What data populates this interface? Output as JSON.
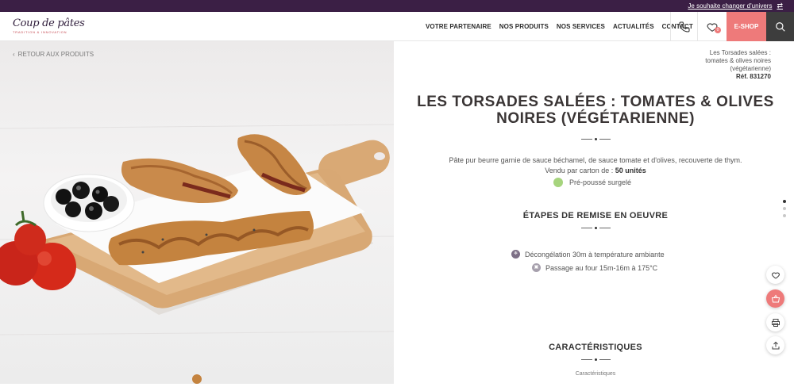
{
  "topbar": {
    "change_universe": "Je souhaite changer d'univers"
  },
  "brand": {
    "logo_text": "Coup de pâtes",
    "tagline": "tradition & innovation"
  },
  "nav": {
    "items": [
      "VOTRE PARTENAIRE",
      "NOS PRODUITS",
      "NOS SERVICES",
      "ACTUALITÉS",
      "CONTACT"
    ]
  },
  "header": {
    "wishlist_count": "0",
    "eshop_label": "E-SHOP"
  },
  "back_link": "RETOUR AUX PRODUITS",
  "reference": {
    "name_line1": "Les Torsades salées :",
    "name_line2": "tomates & olives noires",
    "name_line3": "(végétarienne)",
    "ref": "Réf. 831270"
  },
  "product": {
    "title": "LES TORSADES SALÉES : TOMATES & OLIVES NOIRES (VÉGÉTARIENNE)",
    "description": "Pâte pur beurre garnie de sauce béchamel, de sauce tomate et d'olives, recouverte de thym.",
    "carton_prefix": "Vendu par carton de :",
    "carton_value": "50 unités",
    "state": "Pré-poussé surgelé",
    "state_color": "#a6d47d"
  },
  "steps": {
    "title": "ÉTAPES DE REMISE EN OEUVRE",
    "items": [
      "Décongélation 30m à température ambiante",
      "Passage au four 15m-16m à 175°C"
    ]
  },
  "characteristics": {
    "title": "CARACTÉRISTIQUES",
    "subtitle": "Caractéristiques"
  },
  "colors": {
    "topbar": "#3b1f45",
    "accent": "#ee7a7a",
    "dark": "#3d3d3d"
  },
  "icons": [
    "phone-icon",
    "heart-icon",
    "search-icon",
    "chevron-left-icon",
    "swap-icon",
    "basket-icon",
    "print-icon",
    "share-icon"
  ]
}
